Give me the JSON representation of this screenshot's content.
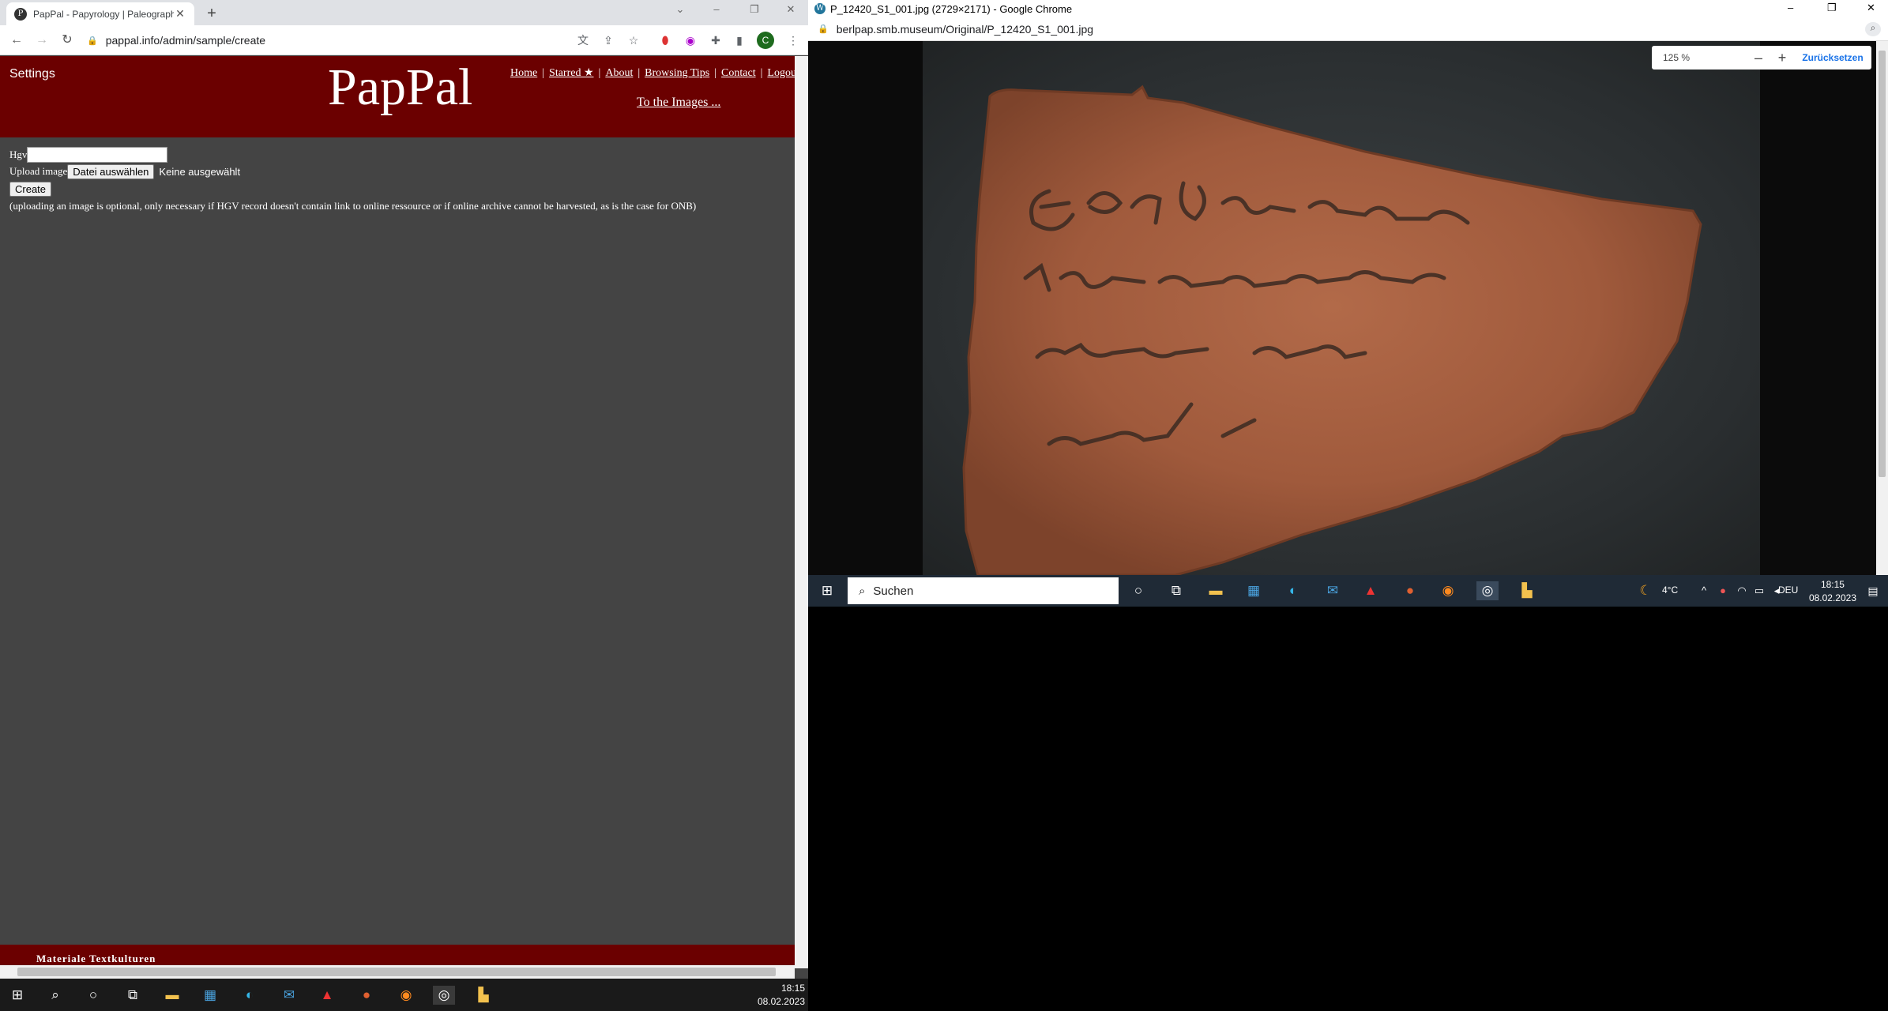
{
  "left": {
    "tab": {
      "title": "PapPal - Papyrology | Paleograph",
      "favicon": "P"
    },
    "url": "pappal.info/admin/sample/create",
    "profile_initial": "C",
    "header": {
      "settings": "Settings",
      "logo": "PapPal",
      "nav": [
        "Home",
        "Starred ★",
        "About",
        "Browsing Tips",
        "Contact",
        "Logou"
      ],
      "to_images": "To the Images ..."
    },
    "form": {
      "hgv_label": "Hgv",
      "hgv_value": "",
      "upload_label": "Upload image",
      "choose_file": "Datei auswählen",
      "no_file": "Keine ausgewählt",
      "create": "Create",
      "note": "(uploading an image is optional, only necessary if HGV record doesn't contain link to online ressource or if online archive cannot be harvested, as is the case for ONB)"
    },
    "footer": "Materiale Textkulturen",
    "taskbar": {
      "time": "18:15",
      "date": "08.02.2023"
    }
  },
  "right": {
    "title": "P_12420_S1_001.jpg (2729×2171) - Google Chrome",
    "url": "berlpap.smb.museum/Original/P_12420_S1_001.jpg",
    "zoom": "125 %",
    "reset": "Zurücksetzen",
    "taskbar": {
      "search_placeholder": "Suchen",
      "temp": "4°C",
      "lang": "DEU",
      "time": "18:15",
      "date": "08.02.2023"
    }
  }
}
